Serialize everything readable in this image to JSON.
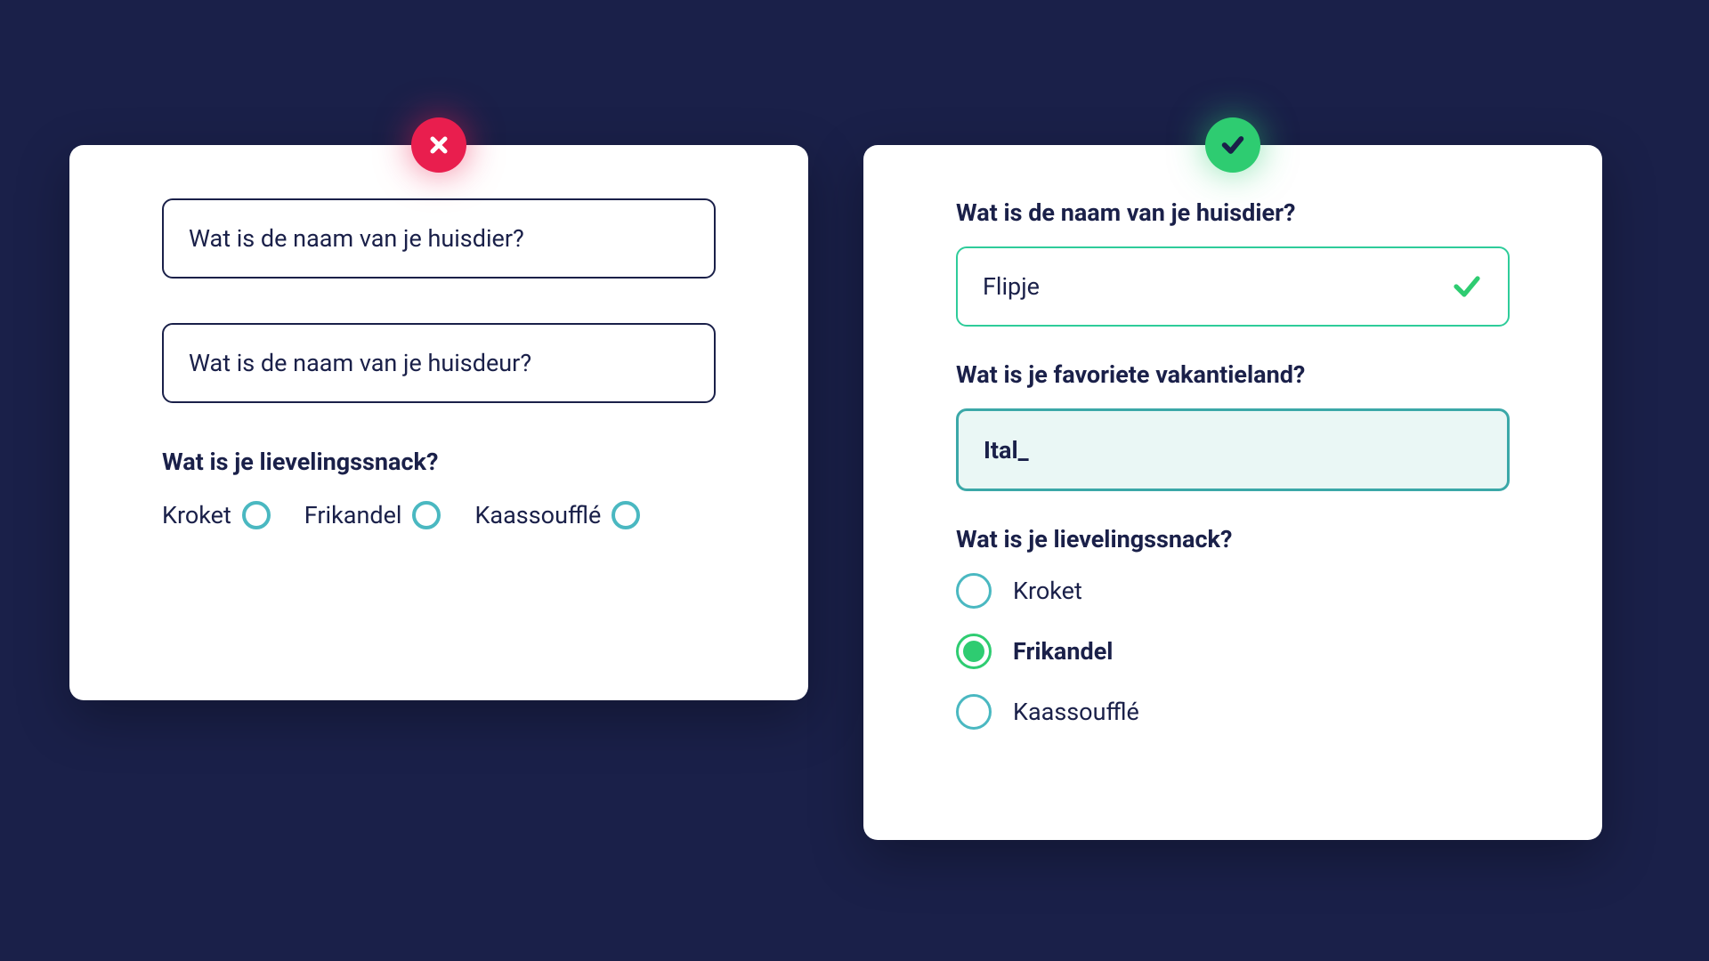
{
  "left_card": {
    "input1_placeholder": "Wat is de naam van je huisdier?",
    "input2_placeholder": "Wat is de naam van je huisdeur?",
    "question": "Wat is je lievelingssnack?",
    "options": {
      "opt1": "Kroket",
      "opt2": "Frikandel",
      "opt3": "Kaassoufflé"
    }
  },
  "right_card": {
    "label1": "Wat is de naam van je huisdier?",
    "input1_value": "Flipje",
    "label2": "Wat is je favoriete vakantieland?",
    "input2_value": "Ital_",
    "question": "Wat is je lievelingssnack?",
    "options": {
      "opt1": "Kroket",
      "opt2": "Frikandel",
      "opt3": "Kaassoufflé"
    },
    "selected_index": 1
  },
  "colors": {
    "background": "#1a2049",
    "error": "#e91e4e",
    "success": "#2ecc71",
    "teal": "#4ab8c1"
  }
}
